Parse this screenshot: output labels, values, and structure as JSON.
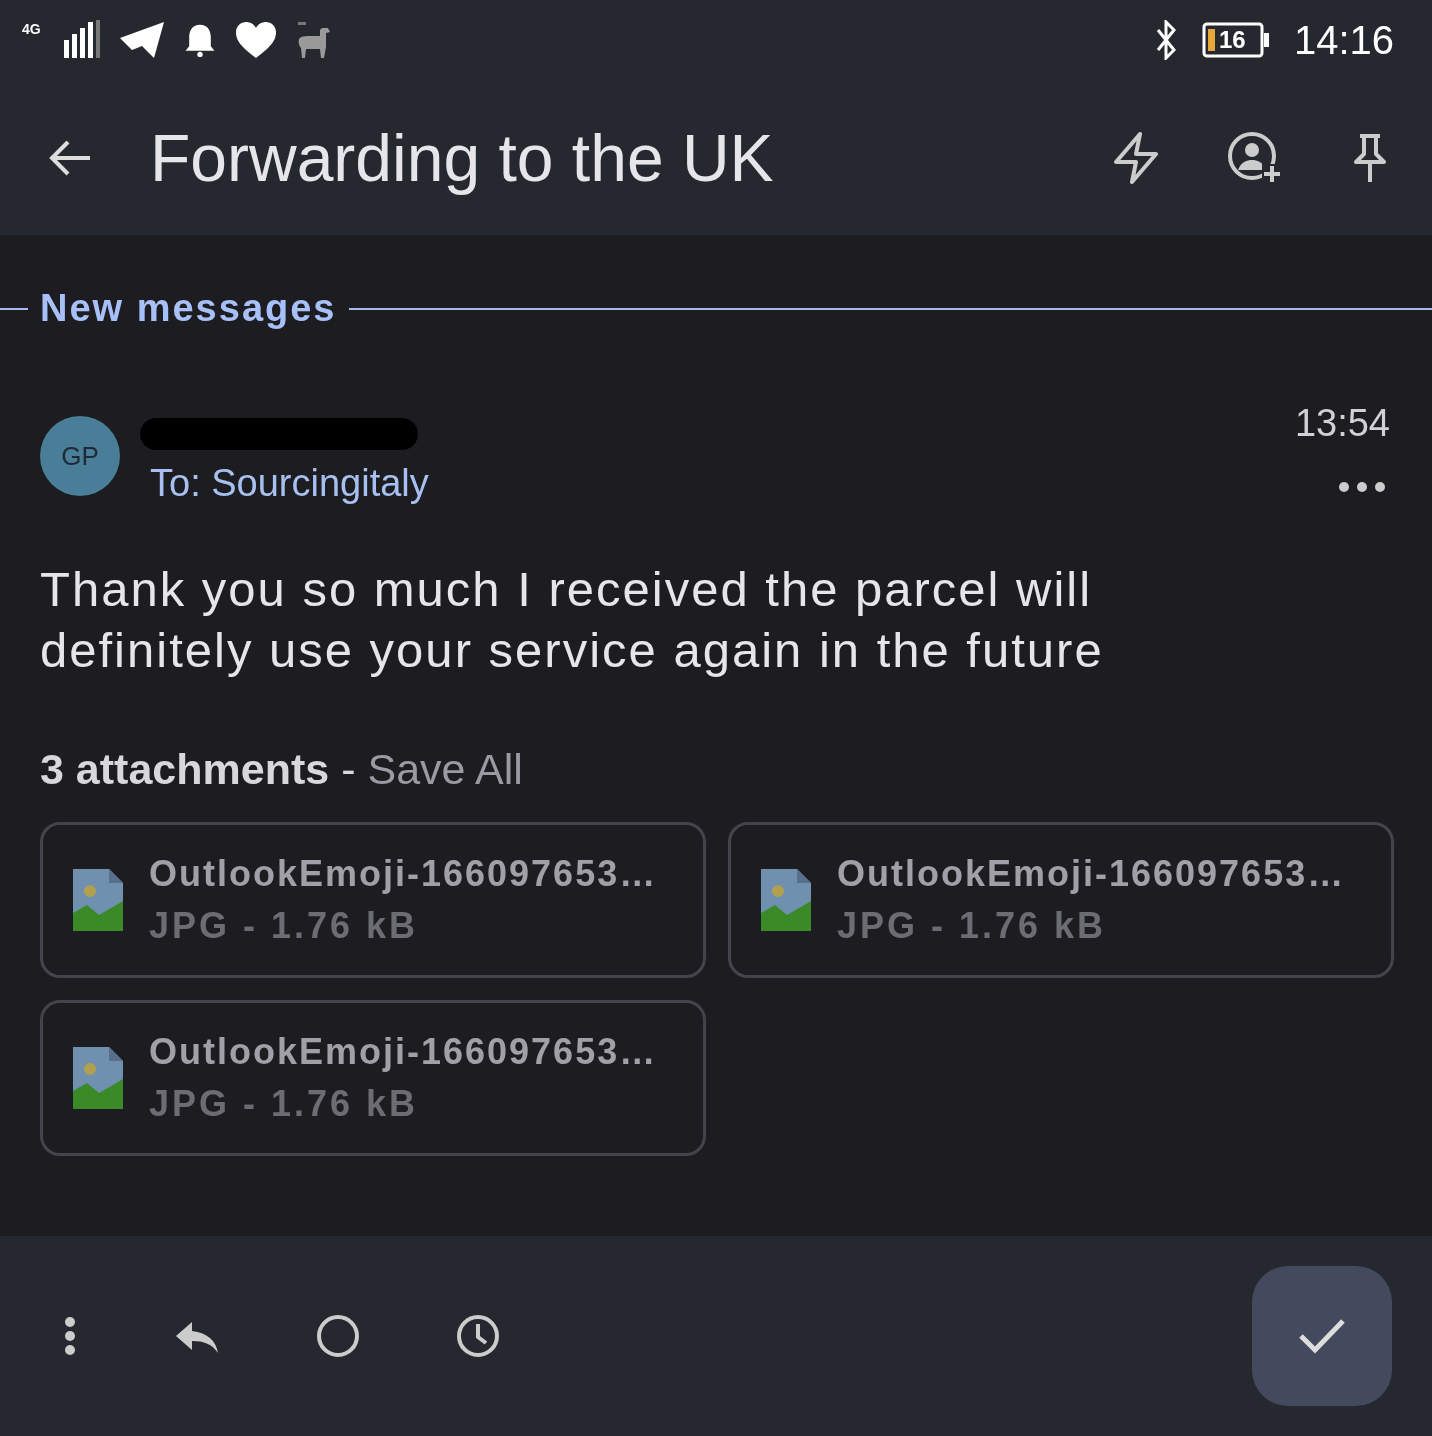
{
  "status_bar": {
    "network": "4G",
    "battery": "16",
    "time": "14:16"
  },
  "header": {
    "title": "Forwarding to the UK"
  },
  "divider_label": "New messages",
  "message": {
    "avatar_initials": "GP",
    "time": "13:54",
    "recipient": "To: Sourcingitaly",
    "body": "Thank you so much I received the parcel will definitely use your service again in the future"
  },
  "attachments": {
    "count_label": "3 attachments",
    "separator": "-",
    "save_all": "Save All",
    "items": [
      {
        "name": "OutlookEmoji-166097653…",
        "meta": "JPG - 1.76 kB"
      },
      {
        "name": "OutlookEmoji-166097653…",
        "meta": "JPG - 1.76 kB"
      },
      {
        "name": "OutlookEmoji-166097653…",
        "meta": "JPG - 1.76 kB"
      }
    ]
  }
}
